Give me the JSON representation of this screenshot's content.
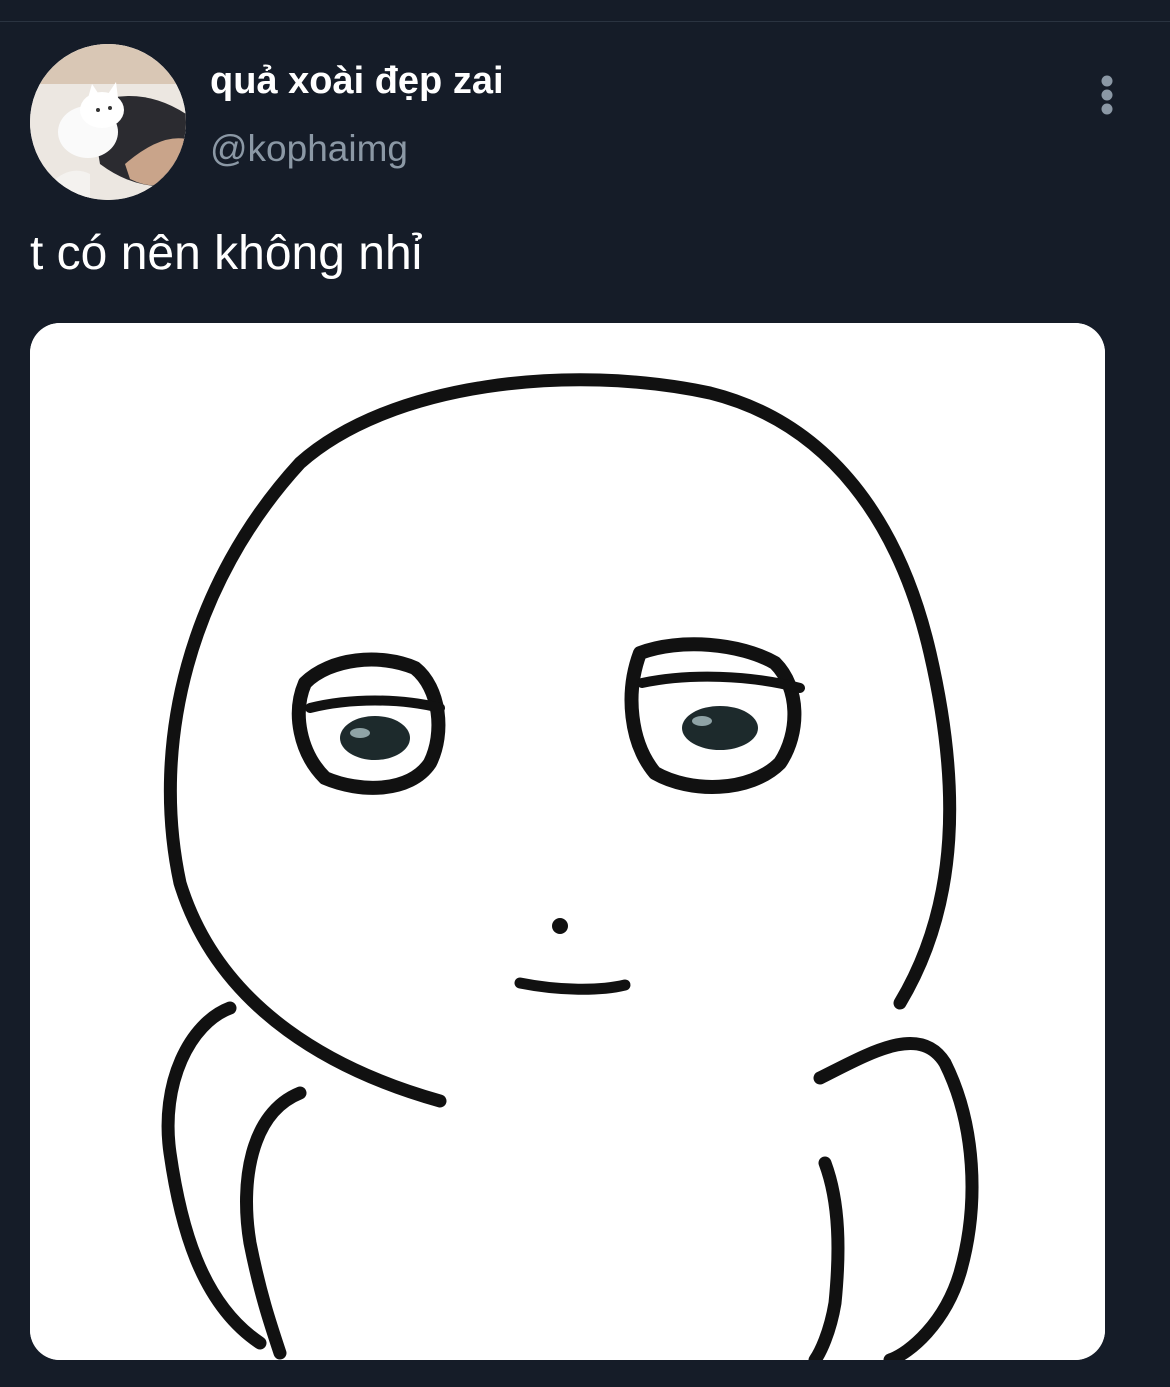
{
  "tweet": {
    "author": {
      "display_name": "quả xoài đẹp zai",
      "handle": "@kophaimg",
      "avatar_icon": "cat-photo-avatar"
    },
    "text": "t có nên không nhỉ",
    "more_icon": "vertical-ellipsis-icon",
    "media": {
      "type": "image",
      "description_icon": "meme-character-drawing"
    }
  },
  "colors": {
    "background": "#151c28",
    "primary_text": "#ffffff",
    "secondary_text": "#8b98a5",
    "icon": "#8b98a5"
  }
}
